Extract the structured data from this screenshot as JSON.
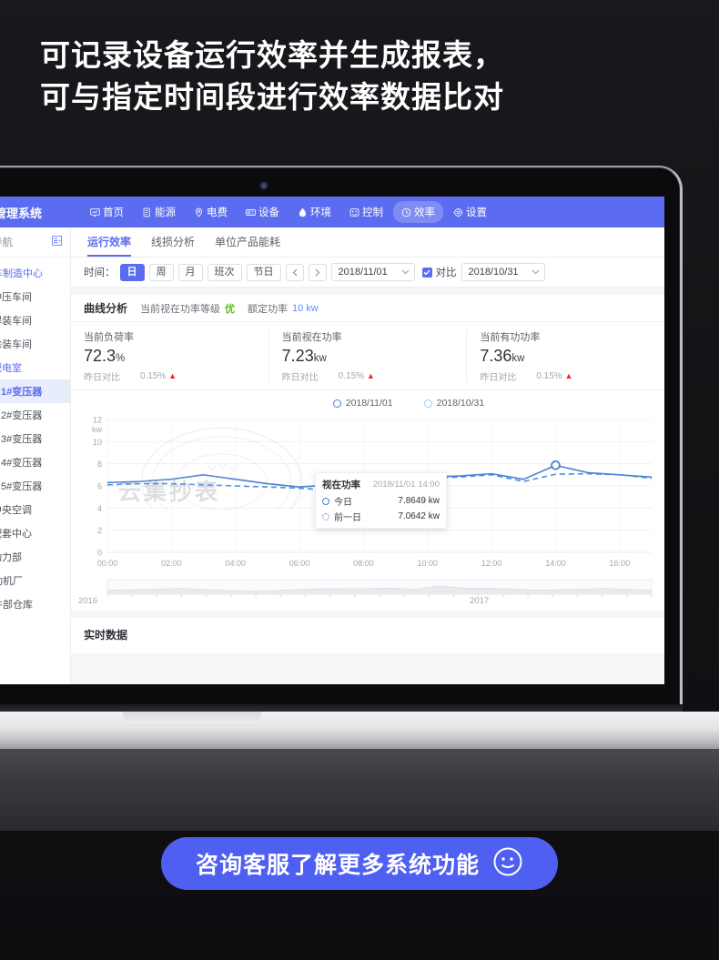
{
  "headline": {
    "line1": "可记录设备运行效率并生成报表，",
    "line2": "可与指定时间段进行效率数据比对"
  },
  "app": {
    "brand": "能源管理系统",
    "nav": [
      {
        "label": "首页",
        "icon": "monitor-chart-icon",
        "active": false
      },
      {
        "label": "能源",
        "icon": "document-icon",
        "active": false
      },
      {
        "label": "电费",
        "icon": "location-pin-icon",
        "active": false
      },
      {
        "label": "设备",
        "icon": "device-box-icon",
        "active": false
      },
      {
        "label": "环境",
        "icon": "droplet-icon",
        "active": false
      },
      {
        "label": "控制",
        "icon": "control-panel-icon",
        "active": false
      },
      {
        "label": "效率",
        "icon": "clock-icon",
        "active": true
      },
      {
        "label": "设置",
        "icon": "gear-icon",
        "active": false
      }
    ]
  },
  "sidebar": {
    "title": "位置导航",
    "collapse_icon": "menu-fold-icon",
    "items": [
      {
        "label": "汽车制造中心",
        "level": 0,
        "state": "blue",
        "icon": "location-pin-icon"
      },
      {
        "label": "冲压车间",
        "level": 1,
        "state": "normal",
        "icon": "location-pin-icon"
      },
      {
        "label": "焊装车间",
        "level": 1,
        "state": "normal",
        "icon": "location-pin-icon"
      },
      {
        "label": "涂装车间",
        "level": 1,
        "state": "normal",
        "icon": "location-pin-icon"
      },
      {
        "label": "配电室",
        "level": 1,
        "state": "blue",
        "icon": "location-pin-icon"
      },
      {
        "label": "1#变压器",
        "level": 2,
        "state": "sel",
        "icon": "transformer-icon"
      },
      {
        "label": "2#变压器",
        "level": 2,
        "state": "normal",
        "icon": "transformer-icon"
      },
      {
        "label": "3#变压器",
        "level": 2,
        "state": "normal",
        "icon": "transformer-icon"
      },
      {
        "label": "4#变压器",
        "level": 2,
        "state": "normal",
        "icon": "transformer-icon"
      },
      {
        "label": "5#变压器",
        "level": 2,
        "state": "normal",
        "icon": "transformer-icon"
      },
      {
        "label": "中央空调",
        "level": 1,
        "state": "normal",
        "icon": "location-pin-icon"
      },
      {
        "label": "配套中心",
        "level": 1,
        "state": "normal",
        "icon": "location-pin-icon"
      },
      {
        "label": "动力部",
        "level": 1,
        "state": "normal",
        "icon": "location-pin-icon"
      },
      {
        "label": "发动机厂",
        "level": 0,
        "state": "normal",
        "icon": "location-pin-icon"
      },
      {
        "label": "零件部仓库",
        "level": 0,
        "state": "normal",
        "icon": "location-pin-icon"
      }
    ]
  },
  "tabs": [
    {
      "label": "运行效率",
      "active": true
    },
    {
      "label": "线损分析",
      "active": false
    },
    {
      "label": "单位产品能耗",
      "active": false
    }
  ],
  "filter": {
    "time_label": "时间：",
    "segments": [
      {
        "label": "日",
        "on": true
      },
      {
        "label": "周",
        "on": false
      },
      {
        "label": "月",
        "on": false
      },
      {
        "label": "班次",
        "on": false
      },
      {
        "label": "节日",
        "on": false
      }
    ],
    "prev_icon": "chevron-left-icon",
    "next_icon": "chevron-right-icon",
    "date_primary": "2018/11/01",
    "compare_label": "对比",
    "compare_checked": true,
    "date_compare": "2018/10/31",
    "chevron_icon": "chevron-down-icon"
  },
  "curve_card": {
    "title": "曲线分析",
    "meta": [
      {
        "label": "当前视在功率等级",
        "value": "优",
        "tone": "green"
      },
      {
        "label": "额定功率",
        "value": "10 kw",
        "tone": "blue"
      }
    ],
    "stats": [
      {
        "label": "当前负荷率",
        "value": "72.3",
        "unit": "%",
        "compare_label": "昨日对比",
        "delta": "0.15%",
        "trend": "up"
      },
      {
        "label": "当前视在功率",
        "value": "7.23",
        "unit": "kw",
        "compare_label": "昨日对比",
        "delta": "0.15%",
        "trend": "up"
      },
      {
        "label": "当前有功功率",
        "value": "7.36",
        "unit": "kw",
        "compare_label": "昨日对比",
        "delta": "0.15%",
        "trend": "up"
      }
    ]
  },
  "tooltip": {
    "title": "视在功率",
    "time": "2018/11/01 14:00",
    "rows": [
      {
        "name": "今日",
        "value": "7.8649 kw",
        "style": "solid"
      },
      {
        "name": "前一日",
        "value": "7.0642 kw",
        "style": "dashed"
      }
    ]
  },
  "slider": {
    "year_left": "2016",
    "year_right": "2017"
  },
  "realtime": {
    "title": "实时数据"
  },
  "cta": {
    "text": "咨询客服了解更多系统功能",
    "icon": "smiley-face-icon"
  },
  "colors": {
    "brand_blue": "#5b6cf0",
    "cta_blue": "#4f5ff2",
    "series_today": "#4a7fd4",
    "series_prev": "#4a90e2",
    "good_green": "#53c41a",
    "up_red": "#f5222d",
    "value_blue": "#5b8ff9",
    "selected_bg": "#e8edfb",
    "transformer_orange": "#faad14"
  },
  "chart_data": {
    "type": "line",
    "title": "视在功率",
    "xlabel": "",
    "ylabel": "kw",
    "ylim": [
      0,
      12
    ],
    "yticks": [
      0,
      2,
      4,
      6,
      8,
      10,
      12
    ],
    "ytick_labels": [
      "0",
      "2",
      "4",
      "6",
      "8",
      "10",
      "12"
    ],
    "y_unit_label": "kw",
    "grid": true,
    "legend_position": "top-right",
    "xticks": [
      "00:00",
      "02:00",
      "04:00",
      "06:00",
      "08:00",
      "10:00",
      "12:00",
      "14:00",
      "16:00"
    ],
    "x": [
      "00:00",
      "01:00",
      "02:00",
      "03:00",
      "04:00",
      "05:00",
      "06:00",
      "07:00",
      "08:00",
      "09:00",
      "10:00",
      "11:00",
      "12:00",
      "13:00",
      "14:00",
      "15:00",
      "16:00",
      "17:00"
    ],
    "highlight": {
      "x": "14:00",
      "series": "2018/11/01",
      "y": 7.8649
    },
    "series": [
      {
        "name": "2018/11/01",
        "style": "solid",
        "color": "#4a7fd4",
        "values": [
          6.3,
          6.4,
          6.6,
          7.0,
          6.6,
          6.2,
          5.9,
          6.1,
          6.5,
          6.8,
          6.8,
          6.9,
          7.1,
          6.6,
          7.86,
          7.2,
          7.0,
          6.8
        ]
      },
      {
        "name": "2018/10/31",
        "style": "dashed",
        "color": "#4a90e2",
        "values": [
          6.1,
          6.2,
          6.2,
          6.1,
          6.0,
          5.9,
          5.8,
          5.6,
          6.3,
          6.6,
          6.7,
          6.8,
          7.0,
          6.4,
          7.06,
          7.1,
          7.0,
          6.7
        ]
      }
    ]
  }
}
